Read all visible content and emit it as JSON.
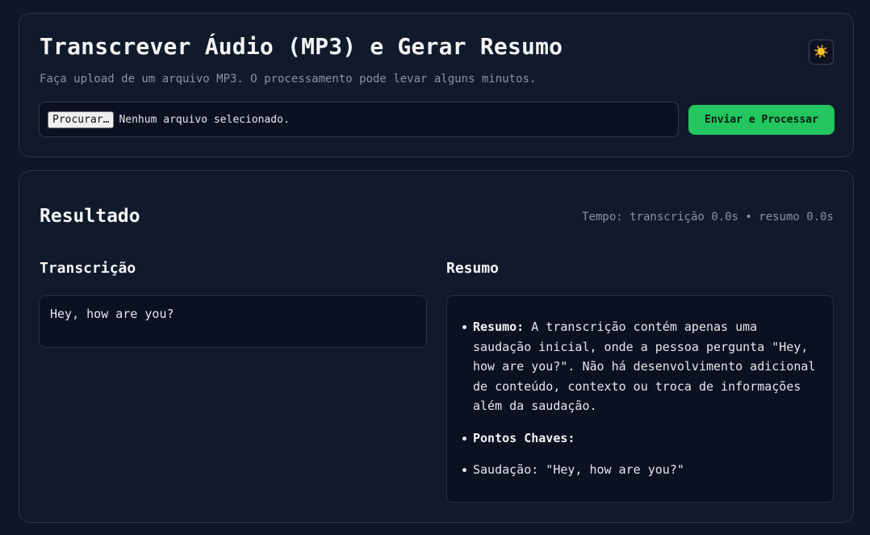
{
  "upload": {
    "title": "Transcrever Áudio (MP3) e Gerar Resumo",
    "subtitle": "Faça upload de um arquivo MP3. O processamento pode levar alguns minutos.",
    "browse_label": "Procurar…",
    "file_status": "Nenhum arquivo selecionado.",
    "submit_label": "Enviar e Processar",
    "theme_toggle_icon": "sun-icon",
    "theme_toggle_glyph": "☀️"
  },
  "result": {
    "title": "Resultado",
    "timing": "Tempo: transcrição 0.0s • resumo 0.0s",
    "transcription": {
      "heading": "Transcrição",
      "text": "Hey, how are you?"
    },
    "summary": {
      "heading": "Resumo",
      "items": [
        {
          "label": "Resumo:",
          "text": " A transcrição contém apenas uma saudação inicial, onde a pessoa pergunta \"Hey, how are you?\". Não há desenvolvimento adicional de conteúdo, contexto ou troca de informações além da saudação."
        },
        {
          "label": "Pontos Chaves:",
          "text": ""
        },
        {
          "label": "",
          "text": "Saudação: \"Hey, how are you?\""
        }
      ]
    }
  },
  "colors": {
    "background": "#0f1726",
    "card": "#111a2b",
    "accent_green": "#22c55e",
    "muted_text": "#8a93a3"
  }
}
